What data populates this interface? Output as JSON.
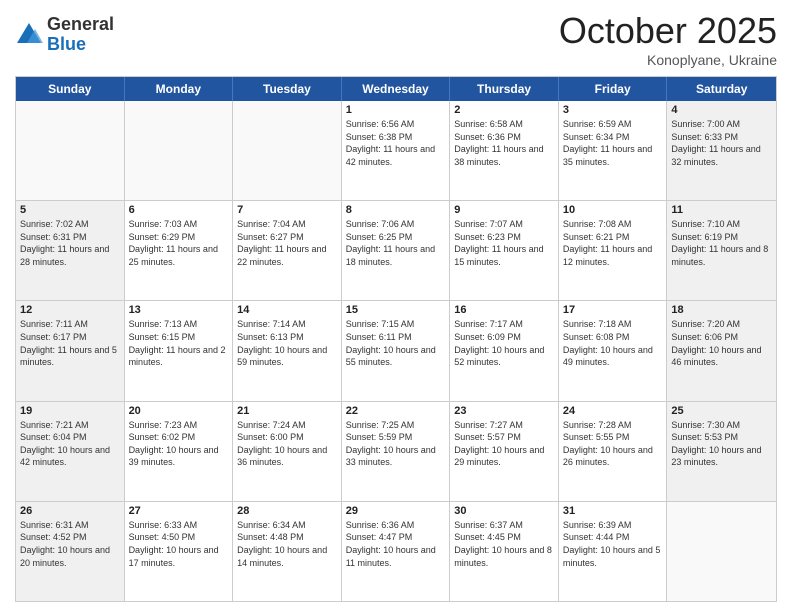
{
  "header": {
    "logo": {
      "general": "General",
      "blue": "Blue"
    },
    "title": "October 2025",
    "location": "Konoplyane, Ukraine"
  },
  "calendar": {
    "days_of_week": [
      "Sunday",
      "Monday",
      "Tuesday",
      "Wednesday",
      "Thursday",
      "Friday",
      "Saturday"
    ],
    "rows": [
      [
        {
          "day": "",
          "empty": true
        },
        {
          "day": "",
          "empty": true
        },
        {
          "day": "",
          "empty": true
        },
        {
          "day": "1",
          "sunrise": "6:56 AM",
          "sunset": "6:38 PM",
          "daylight": "11 hours and 42 minutes."
        },
        {
          "day": "2",
          "sunrise": "6:58 AM",
          "sunset": "6:36 PM",
          "daylight": "11 hours and 38 minutes."
        },
        {
          "day": "3",
          "sunrise": "6:59 AM",
          "sunset": "6:34 PM",
          "daylight": "11 hours and 35 minutes."
        },
        {
          "day": "4",
          "sunrise": "7:00 AM",
          "sunset": "6:33 PM",
          "daylight": "11 hours and 32 minutes.",
          "shaded": true
        }
      ],
      [
        {
          "day": "5",
          "sunrise": "7:02 AM",
          "sunset": "6:31 PM",
          "daylight": "11 hours and 28 minutes.",
          "shaded": true
        },
        {
          "day": "6",
          "sunrise": "7:03 AM",
          "sunset": "6:29 PM",
          "daylight": "11 hours and 25 minutes."
        },
        {
          "day": "7",
          "sunrise": "7:04 AM",
          "sunset": "6:27 PM",
          "daylight": "11 hours and 22 minutes."
        },
        {
          "day": "8",
          "sunrise": "7:06 AM",
          "sunset": "6:25 PM",
          "daylight": "11 hours and 18 minutes."
        },
        {
          "day": "9",
          "sunrise": "7:07 AM",
          "sunset": "6:23 PM",
          "daylight": "11 hours and 15 minutes."
        },
        {
          "day": "10",
          "sunrise": "7:08 AM",
          "sunset": "6:21 PM",
          "daylight": "11 hours and 12 minutes."
        },
        {
          "day": "11",
          "sunrise": "7:10 AM",
          "sunset": "6:19 PM",
          "daylight": "11 hours and 8 minutes.",
          "shaded": true
        }
      ],
      [
        {
          "day": "12",
          "sunrise": "7:11 AM",
          "sunset": "6:17 PM",
          "daylight": "11 hours and 5 minutes.",
          "shaded": true
        },
        {
          "day": "13",
          "sunrise": "7:13 AM",
          "sunset": "6:15 PM",
          "daylight": "11 hours and 2 minutes."
        },
        {
          "day": "14",
          "sunrise": "7:14 AM",
          "sunset": "6:13 PM",
          "daylight": "10 hours and 59 minutes."
        },
        {
          "day": "15",
          "sunrise": "7:15 AM",
          "sunset": "6:11 PM",
          "daylight": "10 hours and 55 minutes."
        },
        {
          "day": "16",
          "sunrise": "7:17 AM",
          "sunset": "6:09 PM",
          "daylight": "10 hours and 52 minutes."
        },
        {
          "day": "17",
          "sunrise": "7:18 AM",
          "sunset": "6:08 PM",
          "daylight": "10 hours and 49 minutes."
        },
        {
          "day": "18",
          "sunrise": "7:20 AM",
          "sunset": "6:06 PM",
          "daylight": "10 hours and 46 minutes.",
          "shaded": true
        }
      ],
      [
        {
          "day": "19",
          "sunrise": "7:21 AM",
          "sunset": "6:04 PM",
          "daylight": "10 hours and 42 minutes.",
          "shaded": true
        },
        {
          "day": "20",
          "sunrise": "7:23 AM",
          "sunset": "6:02 PM",
          "daylight": "10 hours and 39 minutes."
        },
        {
          "day": "21",
          "sunrise": "7:24 AM",
          "sunset": "6:00 PM",
          "daylight": "10 hours and 36 minutes."
        },
        {
          "day": "22",
          "sunrise": "7:25 AM",
          "sunset": "5:59 PM",
          "daylight": "10 hours and 33 minutes."
        },
        {
          "day": "23",
          "sunrise": "7:27 AM",
          "sunset": "5:57 PM",
          "daylight": "10 hours and 29 minutes."
        },
        {
          "day": "24",
          "sunrise": "7:28 AM",
          "sunset": "5:55 PM",
          "daylight": "10 hours and 26 minutes."
        },
        {
          "day": "25",
          "sunrise": "7:30 AM",
          "sunset": "5:53 PM",
          "daylight": "10 hours and 23 minutes.",
          "shaded": true
        }
      ],
      [
        {
          "day": "26",
          "sunrise": "6:31 AM",
          "sunset": "4:52 PM",
          "daylight": "10 hours and 20 minutes.",
          "shaded": true
        },
        {
          "day": "27",
          "sunrise": "6:33 AM",
          "sunset": "4:50 PM",
          "daylight": "10 hours and 17 minutes."
        },
        {
          "day": "28",
          "sunrise": "6:34 AM",
          "sunset": "4:48 PM",
          "daylight": "10 hours and 14 minutes."
        },
        {
          "day": "29",
          "sunrise": "6:36 AM",
          "sunset": "4:47 PM",
          "daylight": "10 hours and 11 minutes."
        },
        {
          "day": "30",
          "sunrise": "6:37 AM",
          "sunset": "4:45 PM",
          "daylight": "10 hours and 8 minutes."
        },
        {
          "day": "31",
          "sunrise": "6:39 AM",
          "sunset": "4:44 PM",
          "daylight": "10 hours and 5 minutes."
        },
        {
          "day": "",
          "empty": true,
          "shaded": true
        }
      ]
    ]
  }
}
